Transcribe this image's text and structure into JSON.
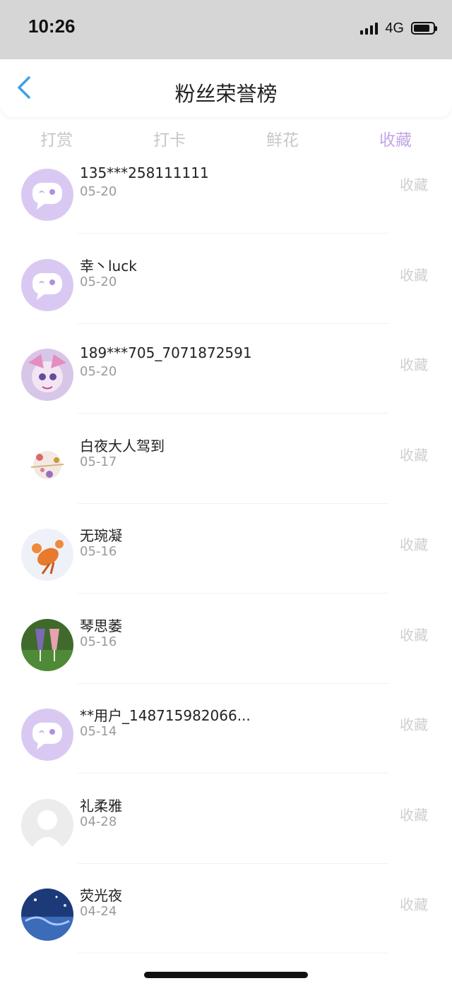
{
  "status": {
    "time": "10:26",
    "network": "4G",
    "battery_level": 0.85
  },
  "nav": {
    "title": "粉丝荣誉榜",
    "back_icon": "chevron-left-icon",
    "back_color": "#3aa2e6"
  },
  "tabs": [
    {
      "label": "打赏",
      "active": false
    },
    {
      "label": "打卡",
      "active": false
    },
    {
      "label": "鲜花",
      "active": false
    },
    {
      "label": "收藏",
      "active": true
    }
  ],
  "colors": {
    "accent": "#c3a7e6",
    "inactive_tab": "#c7c7c7",
    "action_text": "#cfcfcf"
  },
  "fans": [
    {
      "name": "135***258111111",
      "date": "05-20",
      "action": "收藏",
      "avatar": "default-chat-avatar"
    },
    {
      "name": "幸丶luck",
      "date": "05-20",
      "action": "收藏",
      "avatar": "default-chat-avatar"
    },
    {
      "name": "189***705_7071872591",
      "date": "05-20",
      "action": "收藏",
      "avatar": "anime-character-avatar"
    },
    {
      "name": "白夜大人驾到",
      "date": "05-17",
      "action": "收藏",
      "avatar": "illustration-avatar"
    },
    {
      "name": "无琬凝",
      "date": "05-16",
      "action": "收藏",
      "avatar": "lobster-avatar"
    },
    {
      "name": "琴思萎",
      "date": "05-16",
      "action": "收藏",
      "avatar": "drinks-avatar"
    },
    {
      "name": "**用户_148715982066...",
      "date": "05-14",
      "action": "收藏",
      "avatar": "default-chat-avatar"
    },
    {
      "name": "礼柔雅",
      "date": "04-28",
      "action": "收藏",
      "avatar": "default-person-avatar"
    },
    {
      "name": "荧光夜",
      "date": "04-24",
      "action": "收藏",
      "avatar": "night-sky-avatar"
    }
  ]
}
